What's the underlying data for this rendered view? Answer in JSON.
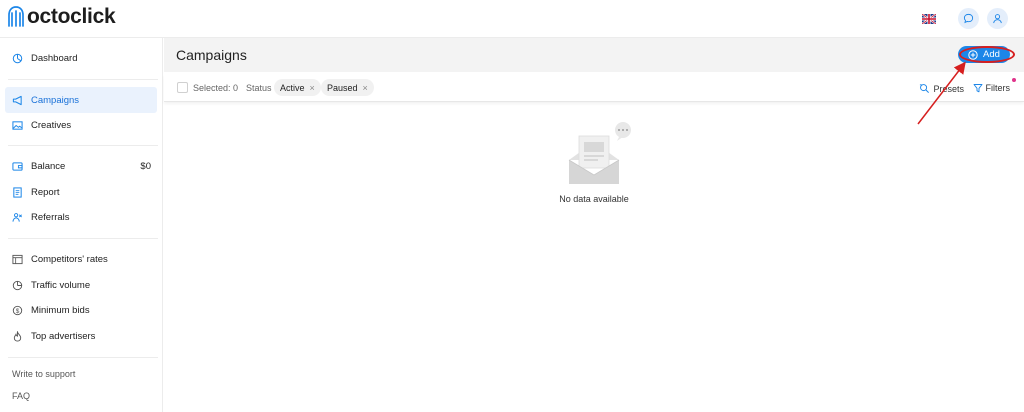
{
  "app": {
    "logo_text": "octoclick"
  },
  "topbar": {
    "flag_icon": "uk-flag-icon",
    "chat_icon": "chat-icon",
    "user_icon": "user-icon"
  },
  "sidebar": {
    "group1": [
      {
        "label": "Dashboard",
        "icon": "dashboard-icon"
      }
    ],
    "group2": [
      {
        "label": "Campaigns",
        "icon": "megaphone-icon",
        "active": true
      },
      {
        "label": "Creatives",
        "icon": "image-icon"
      }
    ],
    "group3": [
      {
        "label": "Balance",
        "icon": "wallet-icon",
        "value": "$0"
      },
      {
        "label": "Report",
        "icon": "report-icon"
      },
      {
        "label": "Referrals",
        "icon": "referrals-icon"
      }
    ],
    "group4": [
      {
        "label": "Competitors' rates",
        "icon": "rates-icon"
      },
      {
        "label": "Traffic volume",
        "icon": "pie-icon"
      },
      {
        "label": "Minimum bids",
        "icon": "dollar-icon"
      },
      {
        "label": "Top advertisers",
        "icon": "flame-icon"
      }
    ],
    "footer": {
      "support": "Write to support",
      "faq": "FAQ"
    }
  },
  "main": {
    "title": "Campaigns",
    "add_label": "Add",
    "filters": {
      "selected_label": "Selected: 0",
      "status_label": "Status",
      "chips": [
        "Active",
        "Paused"
      ],
      "presets_label": "Presets",
      "filters_label": "Filters"
    },
    "empty_text": "No data available"
  },
  "colors": {
    "accent": "#1c86e8",
    "active_bg": "#eaf2fd",
    "annotation": "#d61f1f",
    "dot": "#e0338b"
  }
}
